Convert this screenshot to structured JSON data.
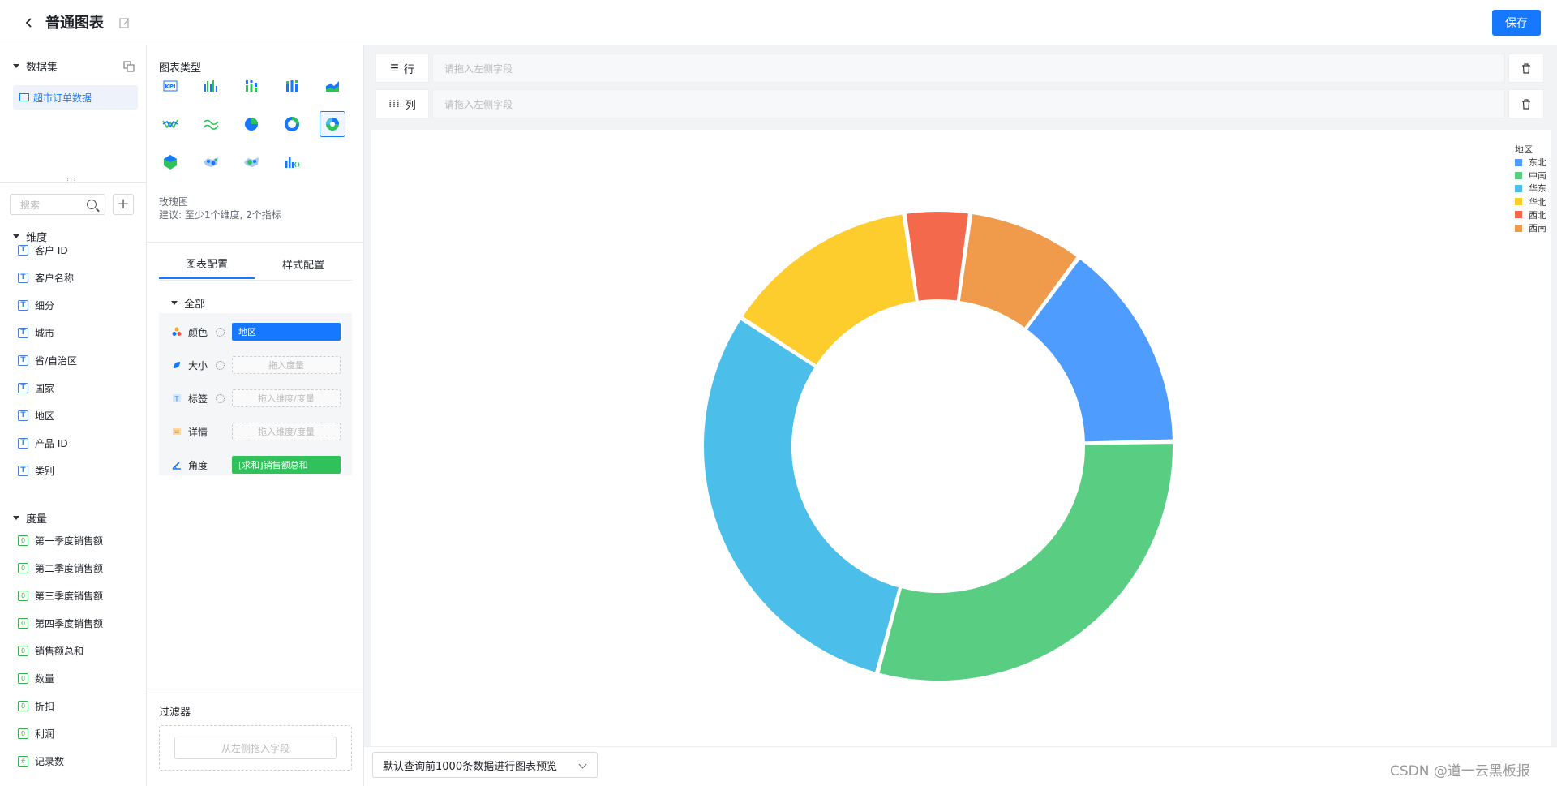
{
  "header": {
    "title": "普通图表",
    "save_label": "保存"
  },
  "dataset": {
    "section_label": "数据集",
    "selected": "超市订单数据",
    "search_placeholder": "搜索",
    "dimension_label": "维度",
    "dimensions": [
      "客户 ID",
      "客户名称",
      "细分",
      "城市",
      "省/自治区",
      "国家",
      "地区",
      "产品 ID",
      "类别"
    ],
    "measure_label": "度量",
    "measures": [
      {
        "badge": "0",
        "name": "第一季度销售额"
      },
      {
        "badge": "0",
        "name": "第二季度销售额"
      },
      {
        "badge": "0",
        "name": "第三季度销售额"
      },
      {
        "badge": "0",
        "name": "第四季度销售额"
      },
      {
        "badge": "0",
        "name": "销售额总和"
      },
      {
        "badge": "0",
        "name": "数量"
      },
      {
        "badge": "0",
        "name": "折扣"
      },
      {
        "badge": "0",
        "name": "利润"
      },
      {
        "badge": "#",
        "name": "记录数"
      }
    ]
  },
  "chart_types": {
    "title": "图表类型",
    "icons": [
      "kpi-icon",
      "grouped-bar-icon",
      "stacked-bar-icon",
      "percent-bar-icon",
      "area-icon",
      "line-icon",
      "wave-line-icon",
      "pie-icon",
      "donut-icon",
      "rose-icon",
      "map-icon",
      "scatter-map-icon",
      "bubble-map-icon",
      "code-chart-icon"
    ],
    "selected_name": "玫瑰图",
    "hint": "建议: 至少1个维度, 2个指标"
  },
  "config": {
    "tabs": [
      "图表配置",
      "样式配置"
    ],
    "group_label": "全部",
    "rows": [
      {
        "label": "颜色",
        "value": "地区",
        "placeholder": ""
      },
      {
        "label": "大小",
        "value": "",
        "placeholder": "拖入度量"
      },
      {
        "label": "标签",
        "value": "",
        "placeholder": "拖入维度/度量"
      },
      {
        "label": "详情",
        "value": "",
        "placeholder": "拖入维度/度量"
      },
      {
        "label": "角度",
        "value": "[求和]销售额总和",
        "placeholder": ""
      }
    ],
    "filter_title": "过滤器",
    "filter_placeholder": "从左侧拖入字段"
  },
  "shelves": {
    "row_label": "行",
    "col_label": "列",
    "placeholder": "请拖入左侧字段"
  },
  "bottom": {
    "preview_label": "默认查询前1000条数据进行图表预览"
  },
  "watermark": "CSDN @道一云黑板报",
  "colors": {
    "accent": "#1677ff",
    "angle_pill": "#2fc25b"
  },
  "chart_data": {
    "type": "pie",
    "legend_title": "地区",
    "legend_position": "top-right",
    "categories": [
      "东北",
      "中南",
      "华东",
      "华北",
      "西北",
      "西南"
    ],
    "colors": [
      "#4e9cfd",
      "#59ce83",
      "#4bbfea",
      "#fdcd2e",
      "#f26a4b",
      "#f09a4b"
    ],
    "values": [
      14.5,
      29.5,
      30.0,
      13.5,
      4.5,
      8.0
    ]
  }
}
